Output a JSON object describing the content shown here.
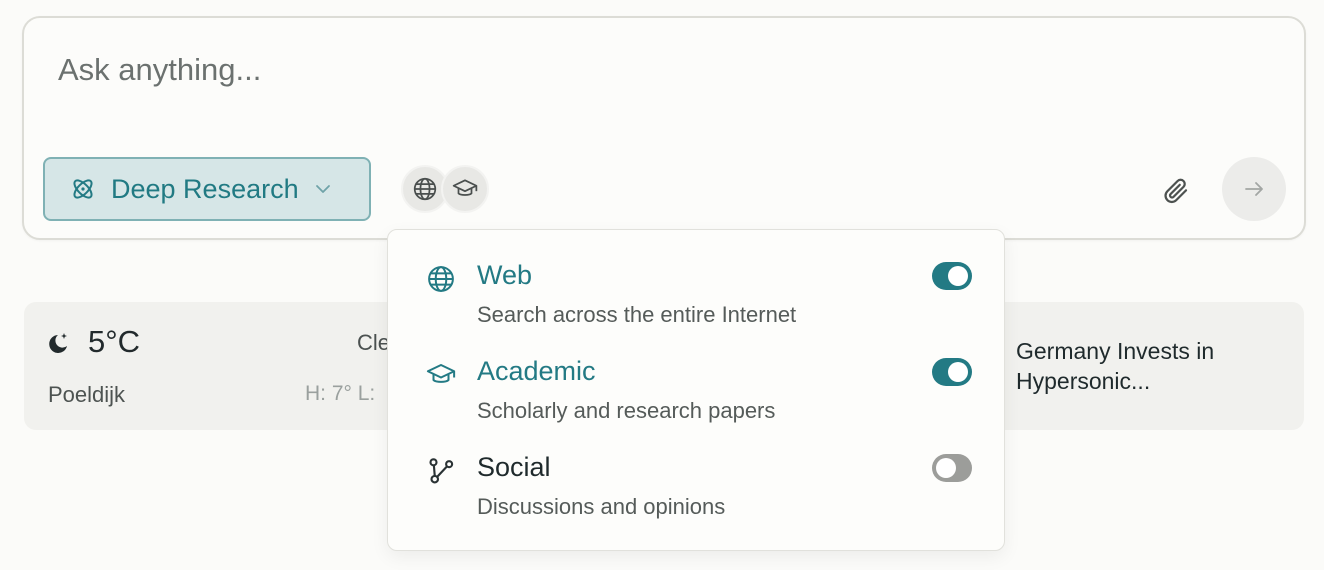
{
  "colors": {
    "accent": "#237a84",
    "mode_bg": "#d6e6e7",
    "toggle_off": "#9c9d9a",
    "card_bg": "#f1f1ee"
  },
  "ask": {
    "placeholder": "Ask anything..."
  },
  "mode": {
    "label": "Deep Research",
    "icon": "atom-icon"
  },
  "source_icons": [
    "globe-icon",
    "graduation-cap-icon"
  ],
  "toolbar": {
    "attach_icon": "paperclip-icon",
    "send_icon": "arrow-right-icon"
  },
  "weather": {
    "icon": "moon-stars-icon",
    "temperature": "5°C",
    "condition": "Cle",
    "location": "Poeldijk",
    "high_low": "H: 7° L:"
  },
  "news": {
    "title": "Germany Invests in Hypersonic..."
  },
  "sources": [
    {
      "key": "web",
      "icon": "globe-icon",
      "title": "Web",
      "description": "Search across the entire Internet",
      "enabled": true
    },
    {
      "key": "academic",
      "icon": "graduation-cap-icon",
      "title": "Academic",
      "description": "Scholarly and research papers",
      "enabled": true
    },
    {
      "key": "social",
      "icon": "network-icon",
      "title": "Social",
      "description": "Discussions and opinions",
      "enabled": false
    }
  ]
}
